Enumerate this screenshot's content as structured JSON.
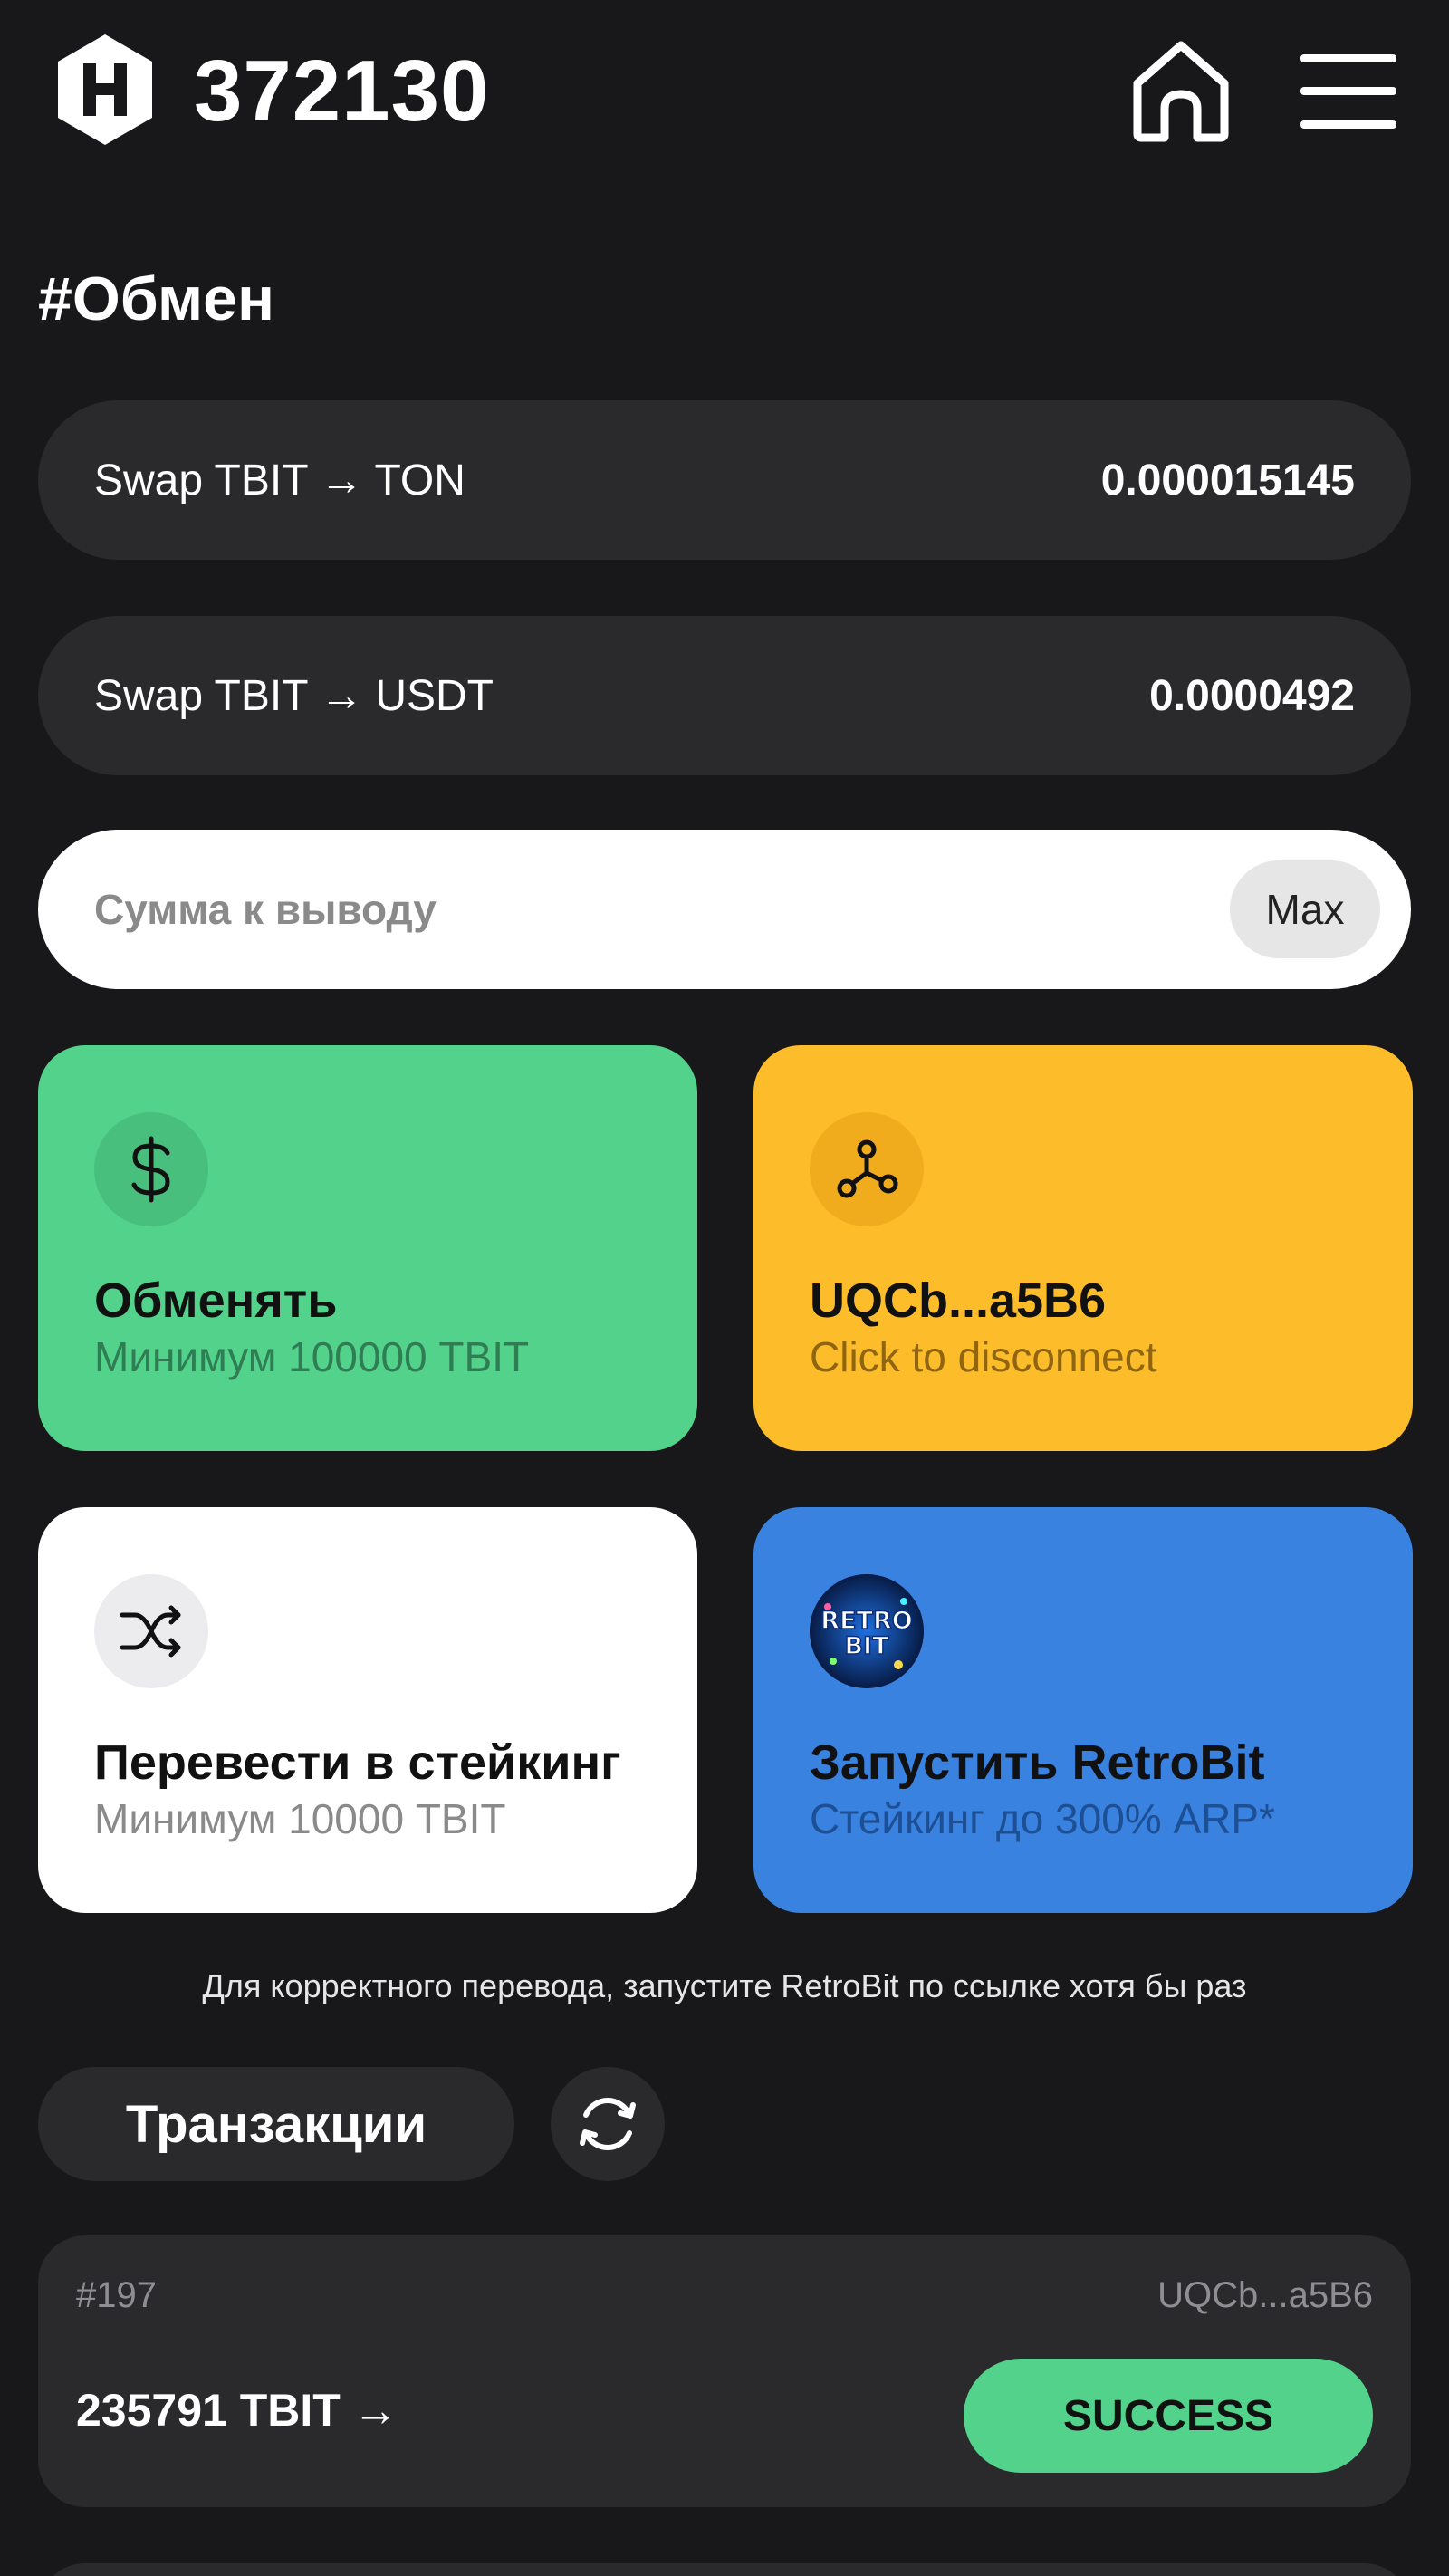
{
  "header": {
    "balance": "372130"
  },
  "section_title": "#Обмен",
  "rates": [
    {
      "label": "Swap TBIT → TON",
      "value": "0.000015145"
    },
    {
      "label": "Swap TBIT → USDT",
      "value": "0.0000492"
    }
  ],
  "amount_field": {
    "placeholder": "Сумма к выводу",
    "value": "",
    "max_label": "Max"
  },
  "tiles": {
    "exchange": {
      "title": "Обменять",
      "subtitle": "Минимум 100000 TBIT",
      "icon": "dollar-icon"
    },
    "wallet": {
      "title": "UQCb...a5B6",
      "subtitle": "Click to disconnect",
      "icon": "network-icon"
    },
    "staking": {
      "title": "Перевести в стейкинг",
      "subtitle": "Минимум 10000 TBIT",
      "icon": "shuffle-icon"
    },
    "retrobit": {
      "title": "Запустить RetroBit",
      "subtitle": "Стейкинг до 300% ARP*",
      "icon": "retrobit-logo",
      "logo_text": [
        "RETRO",
        "BIT"
      ]
    }
  },
  "notice": "Для корректного перевода, запустите RetroBit по ссылке хотя бы раз",
  "transactions": {
    "title": "Транзакции",
    "items": [
      {
        "id": "#197",
        "address": "UQCb...a5B6",
        "amount": "235791 TBIT →",
        "status": "SUCCESS"
      }
    ]
  },
  "colors": {
    "background": "#18181a",
    "card": "#2a2a2c",
    "green": "#52d28b",
    "yellow": "#fdbd2a",
    "blue": "#3a82e0"
  }
}
